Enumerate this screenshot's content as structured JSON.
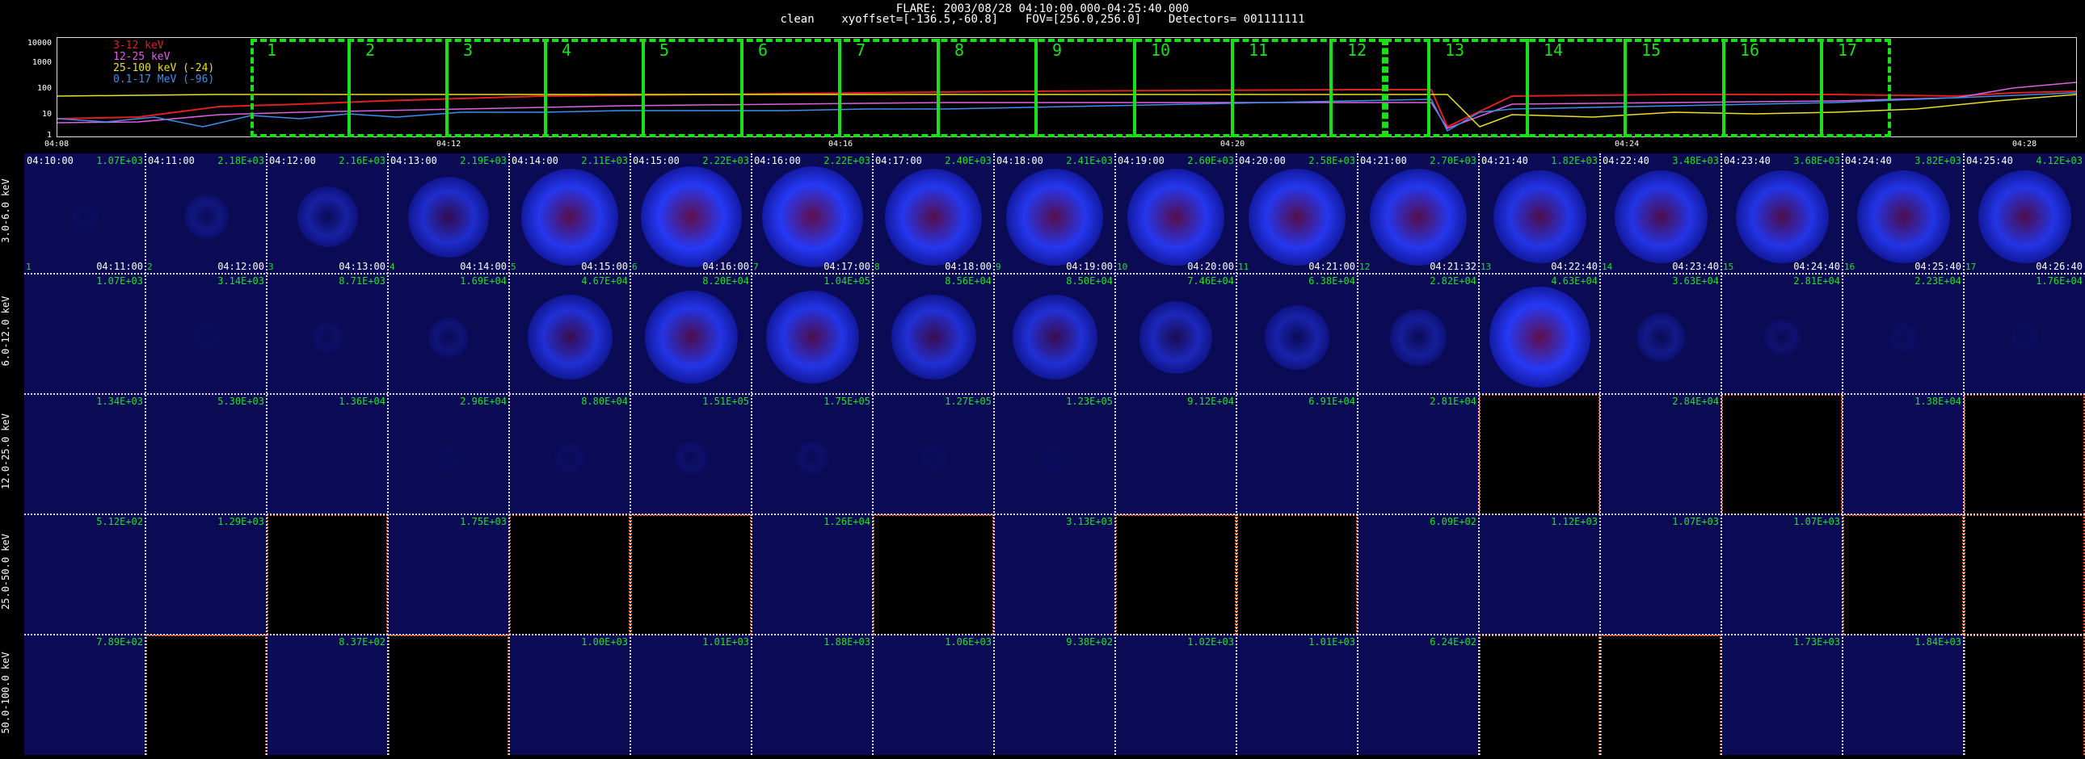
{
  "header": {
    "line1": "FLARE: 2003/08/28 04:10:00.000-04:25:40.000",
    "line2": "clean    xyoffset=[-136.5,-60.8]    FOV=[256.0,256.0]    Detectors= 001111111"
  },
  "lightcurve": {
    "yticks": [
      "10000",
      "1000",
      "100",
      "10",
      "1"
    ],
    "xticks": [
      "04:08",
      "04:12",
      "04:16",
      "04:20",
      "04:24",
      "04:28"
    ],
    "legend": [
      {
        "label": "3-12 keV",
        "color": "#e02020"
      },
      {
        "label": "12-25 keV",
        "color": "#e060e0"
      },
      {
        "label": "25-100 keV (-24)",
        "color": "#e8e020"
      },
      {
        "label": "0.1-17 MeV (-96)",
        "color": "#3a8ef0"
      }
    ],
    "windows": [
      "1",
      "2",
      "3",
      "4",
      "5",
      "6",
      "7",
      "8",
      "9",
      "10",
      "11",
      "12",
      "13",
      "14",
      "15",
      "16",
      "17"
    ]
  },
  "rows": [
    {
      "label": "3.0-6.0 keV"
    },
    {
      "label": "6.0-12.0 keV"
    },
    {
      "label": "12.0-25.0 keV"
    },
    {
      "label": "25.0-50.0 keV"
    },
    {
      "label": "50.0-100.0 keV"
    }
  ],
  "times_start": [
    "04:10:00",
    "04:11:00",
    "04:12:00",
    "04:13:00",
    "04:14:00",
    "04:15:00",
    "04:16:00",
    "04:17:00",
    "04:18:00",
    "04:19:00",
    "04:20:00",
    "04:21:00",
    "04:21:40",
    "04:22:40",
    "04:23:40",
    "04:24:40",
    "04:25:40"
  ],
  "times_end": [
    "04:11:00",
    "04:12:00",
    "04:13:00",
    "04:14:00",
    "04:15:00",
    "04:16:00",
    "04:17:00",
    "04:18:00",
    "04:19:00",
    "04:20:00",
    "04:21:00",
    "04:21:32",
    "04:22:40",
    "04:23:40",
    "04:24:40",
    "04:25:40",
    "04:26:40"
  ],
  "values": [
    [
      "1.07E+03",
      "2.18E+03",
      "2.16E+03",
      "2.19E+03",
      "2.11E+03",
      "2.22E+03",
      "2.22E+03",
      "2.40E+03",
      "2.41E+03",
      "2.60E+03",
      "2.58E+03",
      "2.70E+03",
      "1.82E+03",
      "3.48E+03",
      "3.68E+03",
      "3.82E+03",
      "4.12E+03"
    ],
    [
      "1.07E+03",
      "3.14E+03",
      "8.71E+03",
      "1.69E+04",
      "4.67E+04",
      "8.20E+04",
      "1.04E+05",
      "8.56E+04",
      "8.50E+04",
      "7.46E+04",
      "6.38E+04",
      "2.82E+04",
      "4.63E+04",
      "3.63E+04",
      "2.81E+04",
      "2.23E+04",
      "1.76E+04"
    ],
    [
      "1.34E+03",
      "5.30E+03",
      "1.36E+04",
      "2.96E+04",
      "8.80E+04",
      "1.51E+05",
      "1.75E+05",
      "1.27E+05",
      "1.23E+05",
      "9.12E+04",
      "6.91E+04",
      "2.81E+04",
      "",
      "2.84E+04",
      "",
      "1.38E+04",
      ""
    ],
    [
      "5.12E+02",
      "1.29E+03",
      "",
      "1.75E+03",
      "",
      "",
      "1.26E+04",
      "",
      "3.13E+03",
      "",
      "",
      "6.09E+02",
      "1.12E+03",
      "1.07E+03",
      "1.07E+03",
      "",
      ""
    ],
    [
      "7.89E+02",
      "",
      "8.37E+02",
      "",
      "1.00E+03",
      "1.01E+03",
      "1.88E+03",
      "1.06E+03",
      "9.38E+02",
      "1.02E+03",
      "1.01E+03",
      "6.24E+02",
      "",
      "",
      "1.73E+03",
      "1.84E+03",
      ""
    ]
  ],
  "blank": [
    [
      0,
      0,
      0,
      0,
      0,
      0,
      0,
      0,
      0,
      0,
      0,
      0,
      0,
      0,
      0,
      0,
      0
    ],
    [
      0,
      0,
      0,
      0,
      0,
      0,
      0,
      0,
      0,
      0,
      0,
      0,
      0,
      0,
      0,
      0,
      0
    ],
    [
      0,
      0,
      0,
      0,
      0,
      0,
      0,
      0,
      0,
      0,
      0,
      0,
      1,
      0,
      1,
      0,
      1
    ],
    [
      0,
      0,
      1,
      0,
      1,
      1,
      0,
      1,
      0,
      1,
      1,
      0,
      0,
      0,
      0,
      1,
      1
    ],
    [
      0,
      1,
      0,
      1,
      0,
      0,
      0,
      0,
      0,
      0,
      0,
      0,
      1,
      1,
      0,
      0,
      1
    ]
  ],
  "intensity": [
    [
      0.05,
      0.25,
      0.45,
      0.7,
      0.9,
      0.95,
      0.95,
      0.9,
      0.9,
      0.9,
      0.9,
      0.9,
      0.85,
      0.85,
      0.85,
      0.85,
      0.85
    ],
    [
      0.02,
      0.05,
      0.1,
      0.2,
      0.75,
      0.85,
      0.85,
      0.75,
      0.75,
      0.6,
      0.5,
      0.4,
      0.95,
      0.3,
      0.15,
      0.08,
      0.05
    ],
    [
      0,
      0.02,
      0.03,
      0.04,
      0.08,
      0.12,
      0.12,
      0.05,
      0.04,
      0.03,
      0.02,
      0.01,
      0,
      0.01,
      0,
      0.01,
      0
    ],
    [
      0,
      0,
      0,
      0,
      0,
      0,
      0,
      0,
      0,
      0,
      0,
      0,
      0,
      0,
      0,
      0,
      0
    ],
    [
      0,
      0,
      0,
      0,
      0,
      0,
      0,
      0,
      0,
      0,
      0,
      0,
      0,
      0,
      0,
      0,
      0
    ]
  ]
}
